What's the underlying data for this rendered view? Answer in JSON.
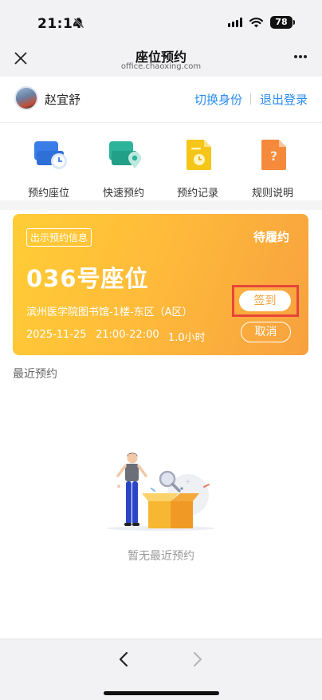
{
  "status_bar": {
    "time": "21:14",
    "battery": "78",
    "icons": [
      "bell-slash-icon",
      "signal-icon",
      "wifi-icon",
      "battery-icon"
    ]
  },
  "nav": {
    "title": "座位预约",
    "url": "office.chaoxing.com",
    "icons": [
      "close-icon",
      "more-icon"
    ]
  },
  "user": {
    "name": "赵宜舒",
    "switch_label": "切换身份",
    "logout_label": "退出登录"
  },
  "quick_menu": [
    {
      "label": "预约座位",
      "icon": "seat-clock-icon",
      "color": "#3b7de8"
    },
    {
      "label": "快速预约",
      "icon": "seat-location-icon",
      "color": "#2cb39a"
    },
    {
      "label": "预约记录",
      "icon": "record-doc-icon",
      "color": "#f5c518"
    },
    {
      "label": "规则说明",
      "icon": "rules-question-icon",
      "color": "#f58a3c"
    }
  ],
  "reservation": {
    "badge": "出示预约信息",
    "status": "待履约",
    "seat": "036号座位",
    "location": "滨州医学院图书馆-1楼-东区（A区）",
    "date": "2025-11-25",
    "time": "21:00-22:00",
    "hours": "1.0小时",
    "checkin_label": "签到",
    "cancel_label": "取消"
  },
  "recent": {
    "title": "最近预约",
    "empty_text": "暂无最近预约"
  },
  "colors": {
    "accent": "#2a8cf0",
    "card_start": "#ffcd35",
    "card_end": "#f7a13f",
    "highlight": "#e8453a"
  },
  "toolbar": {
    "icons": [
      "back-chevron-icon",
      "forward-chevron-icon"
    ]
  }
}
